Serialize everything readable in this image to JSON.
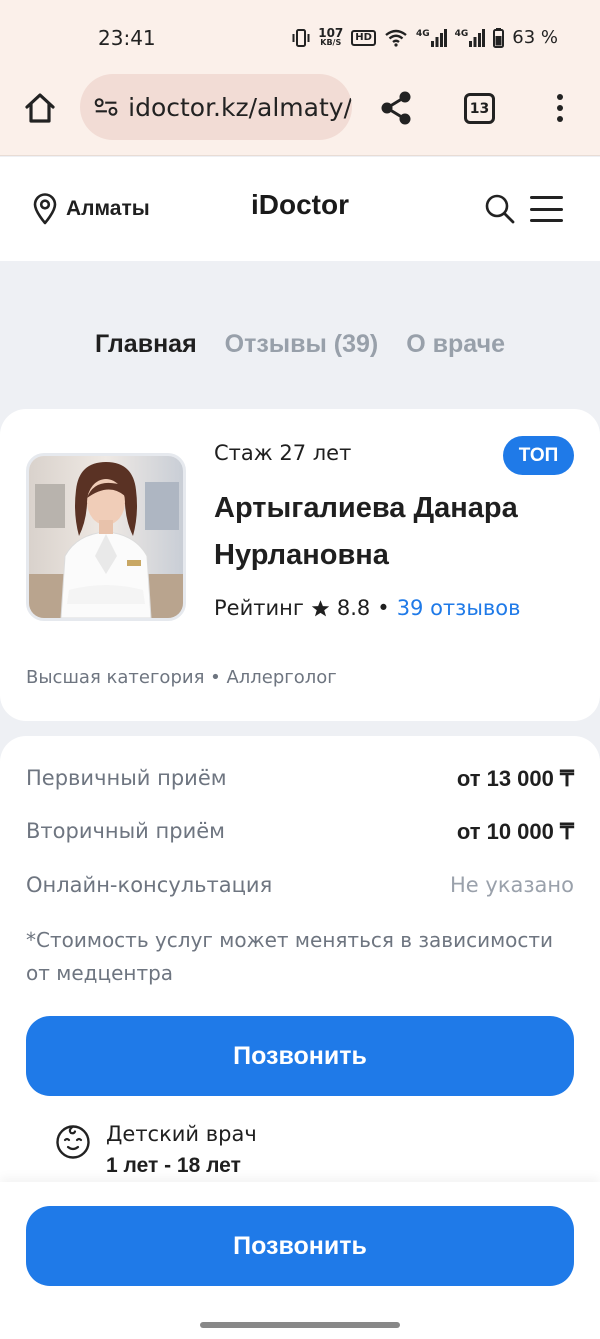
{
  "status_bar": {
    "time": "23:41",
    "net_speed_value": "107",
    "net_speed_unit": "KB/S",
    "hd_label": "HD",
    "signal_1": "4G",
    "signal_2": "4G",
    "battery": "63 %"
  },
  "browser": {
    "url": "idoctor.kz/almaty/",
    "tabs_count": "13"
  },
  "header": {
    "city": "Алматы",
    "logo": "iDoctor"
  },
  "tabs": [
    {
      "label": "Главная",
      "active": true
    },
    {
      "label": "Отзывы (39)",
      "active": false
    },
    {
      "label": "О враче",
      "active": false
    }
  ],
  "doctor": {
    "experience": "Стаж 27 лет",
    "badge": "ТОП",
    "name": "Артыгалиева Данара Нурлановна",
    "rating_label": "Рейтинг",
    "rating_value": "8.8",
    "rating_separator": "•",
    "reviews_link": "39 отзывов",
    "category": "Высшая категория • Аллерголог"
  },
  "prices": [
    {
      "label": "Первичный приём",
      "value": "от 13 000 ₸",
      "muted": false
    },
    {
      "label": "Вторичный приём",
      "value": "от 10 000 ₸",
      "muted": false
    },
    {
      "label": "Онлайн-консультация",
      "value": "Не указано",
      "muted": true
    }
  ],
  "price_note": "*Стоимость услуг может меняться в зависимости от медцентра",
  "call_button": "Позвонить",
  "kids": {
    "title": "Детский врач",
    "ages": "1 лет - 18 лет"
  },
  "sticky_call_button": "Позвонить",
  "colors": {
    "accent": "#1f7ae8",
    "chrome_bg": "#fbf0ea",
    "page_bg": "#eef0f4"
  }
}
